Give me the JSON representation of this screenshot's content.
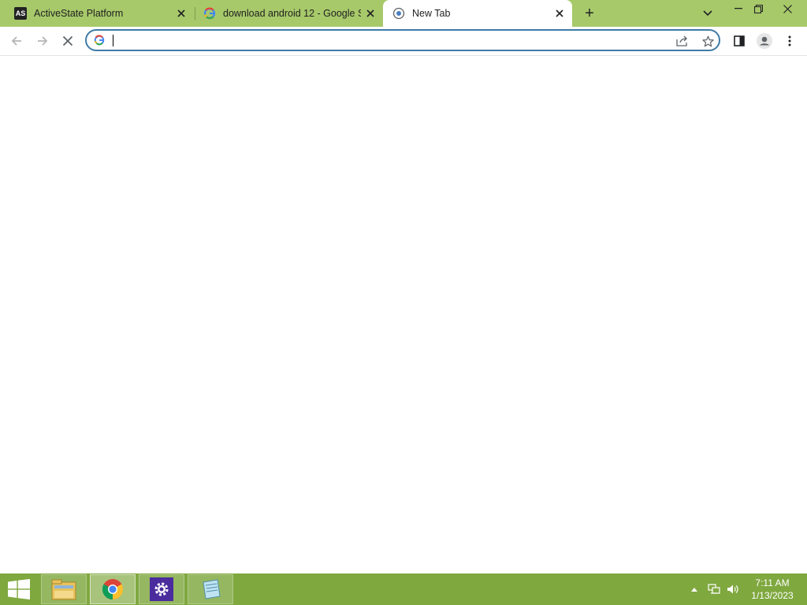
{
  "tabs": [
    {
      "title": "ActiveState Platform",
      "favicon": "activestate-logo-icon",
      "active": false
    },
    {
      "title": "download android 12 - Google S",
      "favicon": "google-g-icon",
      "active": false
    },
    {
      "title": "New Tab",
      "favicon": "chrome-newtab-icon",
      "active": true
    }
  ],
  "new_tab_symbol": "+",
  "favicon_text": {
    "activestate": "AS",
    "google": "G"
  },
  "omnibox": {
    "value": "",
    "placeholder": ""
  },
  "clock": {
    "time": "7:11 AM",
    "date": "1/13/2023"
  },
  "taskbar_apps": [
    {
      "name": "file-explorer-icon",
      "active": false
    },
    {
      "name": "chrome-icon",
      "active": true
    },
    {
      "name": "settings-gear-icon",
      "active": false
    },
    {
      "name": "notepad-icon",
      "active": false
    }
  ],
  "colors": {
    "tabstrip": "#a7c96a",
    "taskbar": "#7fa83f",
    "omnibox_border": "#3f7ba6"
  }
}
